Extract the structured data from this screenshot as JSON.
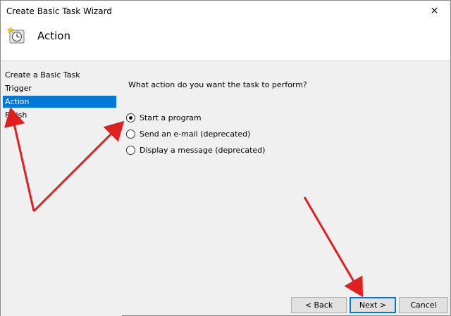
{
  "window": {
    "title": "Create Basic Task Wizard",
    "close_glyph": "✕"
  },
  "header": {
    "title": "Action",
    "icon": "task-scheduler-clock-icon"
  },
  "sidebar": {
    "items": [
      {
        "label": "Create a Basic Task"
      },
      {
        "label": "Trigger"
      },
      {
        "label": "Action",
        "selected": true
      },
      {
        "label": "Finish"
      }
    ]
  },
  "main": {
    "question": "What action do you want the task to perform?",
    "options": [
      {
        "label": "Start a program",
        "checked": true
      },
      {
        "label": "Send an e-mail (deprecated)",
        "checked": false
      },
      {
        "label": "Display a message (deprecated)",
        "checked": false
      }
    ]
  },
  "footer": {
    "back_label": "< Back",
    "next_label": "Next >",
    "cancel_label": "Cancel"
  },
  "colors": {
    "selection": "#0078d7",
    "annotation_arrow": "#e02020"
  }
}
